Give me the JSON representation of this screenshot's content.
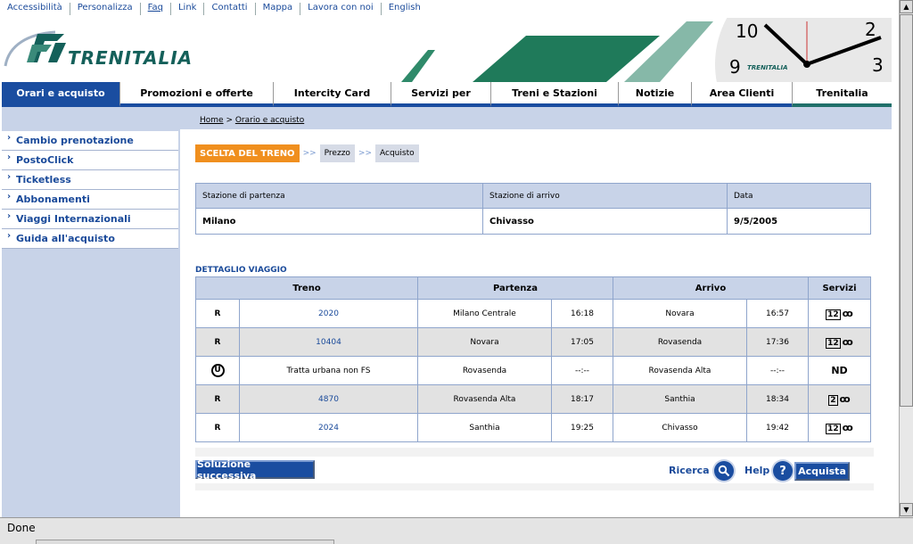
{
  "top_links": [
    "Accessibilità",
    "Personalizza",
    "Faq",
    "Link",
    "Contatti",
    "Mappa",
    "Lavora con noi",
    "English"
  ],
  "brand": {
    "name": "TRENITALIA",
    "clock_brand": "TRENITALIA",
    "clock_numbers": [
      "10",
      "2",
      "9",
      "3"
    ]
  },
  "nav": [
    {
      "label": "Orari e acquisto"
    },
    {
      "label": "Promozioni e offerte"
    },
    {
      "label": "Intercity Card"
    },
    {
      "label": "Servizi per"
    },
    {
      "label": "Treni e Stazioni"
    },
    {
      "label": "Notizie"
    },
    {
      "label": "Area Clienti"
    },
    {
      "label": "Trenitalia"
    }
  ],
  "breadcrumb": {
    "home": "Home",
    "sep": " > ",
    "current": "Orario e acquisto"
  },
  "sidebar": [
    {
      "label": "Cambio prenotazione"
    },
    {
      "label": "PostoClick"
    },
    {
      "label": "Ticketless"
    },
    {
      "label": "Abbonamenti"
    },
    {
      "label": "Viaggi Internazionali"
    },
    {
      "label": "Guida all'acquisto"
    }
  ],
  "steps": {
    "active": "SCELTA DEL TRENO",
    "arrow": ">>",
    "second": "Prezzo",
    "third": "Acquisto"
  },
  "station_table": {
    "headers": [
      "Stazione di partenza",
      "Stazione di arrivo",
      "Data"
    ],
    "values": [
      "Milano",
      "Chivasso",
      "9/5/2005"
    ]
  },
  "detail_title": "DETTAGLIO VIAGGIO",
  "detail_headers": [
    "Treno",
    "Partenza",
    "Arrivo",
    "Servizi"
  ],
  "rows": [
    {
      "icon": "R",
      "train": "2020",
      "dep_station": "Milano Centrale",
      "dep_time": "16:18",
      "arr_station": "Novara",
      "arr_time": "16:57",
      "class": "12",
      "bike": "ꝏ"
    },
    {
      "icon": "R",
      "train": "10404",
      "dep_station": "Novara",
      "dep_time": "17:05",
      "arr_station": "Rovasenda",
      "arr_time": "17:36",
      "class": "12",
      "bike": "ꝏ"
    },
    {
      "icon": "U",
      "train": "Tratta urbana non FS",
      "dep_station": "Rovasenda",
      "dep_time": "--:--",
      "arr_station": "Rovasenda Alta",
      "arr_time": "--:--",
      "class": "ND",
      "bike": ""
    },
    {
      "icon": "R",
      "train": "4870",
      "dep_station": "Rovasenda Alta",
      "dep_time": "18:17",
      "arr_station": "Santhia",
      "arr_time": "18:34",
      "class": "2",
      "bike": "ꝏ"
    },
    {
      "icon": "R",
      "train": "2024",
      "dep_station": "Santhia",
      "dep_time": "19:25",
      "arr_station": "Chivasso",
      "arr_time": "19:42",
      "class": "12",
      "bike": "ꝏ"
    }
  ],
  "actions": {
    "next": "Soluzione successiva",
    "search": "Ricerca",
    "help": "Help",
    "help_icon": "?",
    "buy": "Acquista"
  },
  "status": {
    "text": "Done"
  },
  "colors": {
    "nav_blue": "#1a4da0",
    "orange_step": "#f08f1e",
    "panel_blue": "#c8d3e8",
    "brand_green": "#14605a"
  }
}
